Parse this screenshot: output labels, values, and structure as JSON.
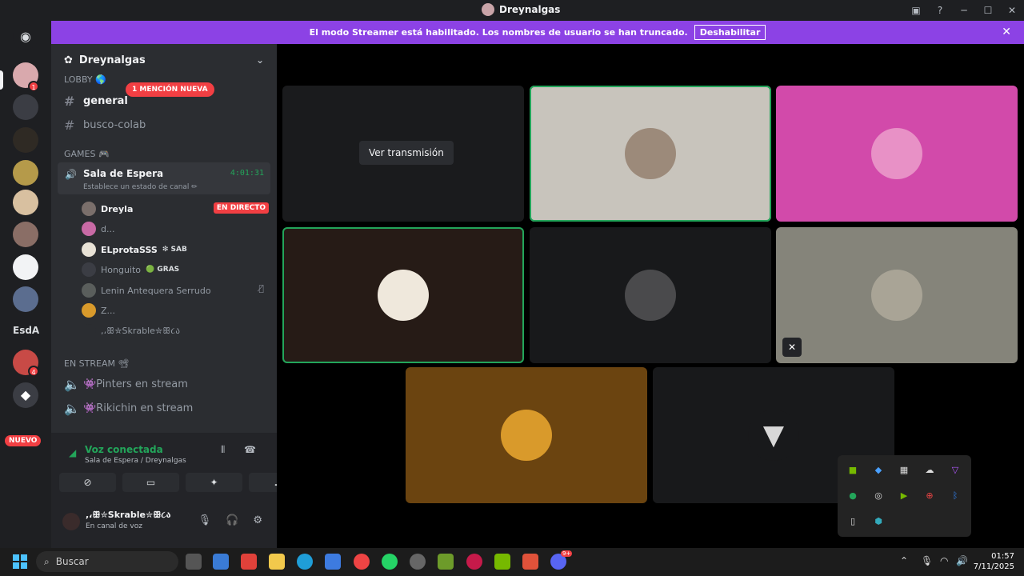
{
  "window": {
    "title": "Dreynalgas",
    "controls": [
      "─",
      "☐",
      "✕"
    ]
  },
  "banner": {
    "text": "El modo Streamer está habilitado. Los nombres de usuario se han truncado.",
    "button": "Deshabilitar"
  },
  "servers": {
    "text_server": "EsdA",
    "new_badge": "NUEVO",
    "badge_top": "1",
    "badge_mid": "4"
  },
  "guild": {
    "name": "Dreynalgas"
  },
  "categories": {
    "lobby": "LOBBY 🌎",
    "games": "GAMES 🎮",
    "stream": "EN STREAM 📽"
  },
  "mention_pill": "1 MENCIÓN NUEVA",
  "channels": {
    "general": "general",
    "busco": "busco-colab",
    "pinters": "👾Pinters en stream",
    "rikichin": "👾Rikichin en stream"
  },
  "voice_channel": {
    "name": "Sala de Espera",
    "status": "Establece un estado de canal ✏",
    "timer": "4:01:31"
  },
  "members": [
    {
      "name": "Dreyla",
      "tag": "",
      "live": "EN DIRECTO"
    },
    {
      "name": "d...",
      "tag": ""
    },
    {
      "name": "ELprotaSSS",
      "tag": "❇ SAB"
    },
    {
      "name": "Honguito",
      "tag": "🟢 GRAS"
    },
    {
      "name": "Lenin Antequera Serrudo",
      "tag": ""
    },
    {
      "name": "Z...",
      "tag": ""
    },
    {
      "name": ",،ꕥ✮Skrable✮ꕥ૮ა",
      "tag": ""
    }
  ],
  "voice_panel": {
    "title": "Voz conectada",
    "subtitle": "Sala de Espera / Dreynalgas"
  },
  "user": {
    "name": ",،ꕥ✮Skrable✮ꕥ૮ა",
    "status": "En canal de voz"
  },
  "stage": {
    "watch_button": "Ver transmisión"
  },
  "colors": {
    "brand": "#8c42e5",
    "speaking": "#23a55a",
    "danger": "#f23f43"
  },
  "taskbar": {
    "search": "Buscar",
    "time": "01:57",
    "date": "7/11/2025",
    "discord_badge": "9+"
  }
}
